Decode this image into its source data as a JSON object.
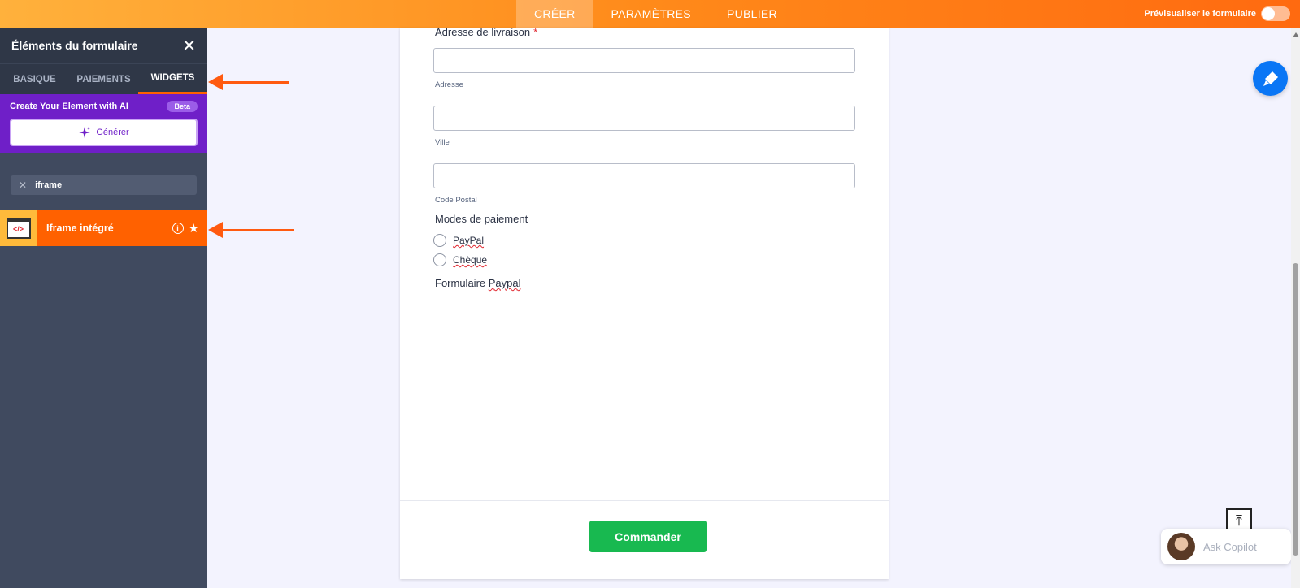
{
  "topbar": {
    "tabs": [
      {
        "label": "CRÉER"
      },
      {
        "label": "PARAMÈTRES"
      },
      {
        "label": "PUBLIER"
      }
    ],
    "preview_label": "Prévisualiser le formulaire",
    "brand_color": "#ff8a1a"
  },
  "sidebar": {
    "title": "Éléments du formulaire",
    "tabs": [
      {
        "label": "BASIQUE"
      },
      {
        "label": "PAIEMENTS"
      },
      {
        "label": "WIDGETS"
      }
    ],
    "ai": {
      "title": "Create Your Element with AI",
      "badge": "Beta",
      "generate_label": "Générer"
    },
    "search_value": "iframe",
    "result": {
      "label": "Iframe intégré",
      "icon_text": "</>"
    }
  },
  "form": {
    "address_label": "Adresse de livraison",
    "required_mark": "*",
    "fields": [
      {
        "sublabel": "Adresse"
      },
      {
        "sublabel": "Ville"
      },
      {
        "sublabel": "Code Postal"
      }
    ],
    "payment_label": "Modes de paiement",
    "payment_options": [
      "PayPal",
      "Chèque"
    ],
    "paypal_form_label_prefix": "Formulaire ",
    "paypal_form_label_word": "Paypal",
    "submit_label": "Commander"
  },
  "copilot": {
    "placeholder": "Ask Copilot"
  }
}
